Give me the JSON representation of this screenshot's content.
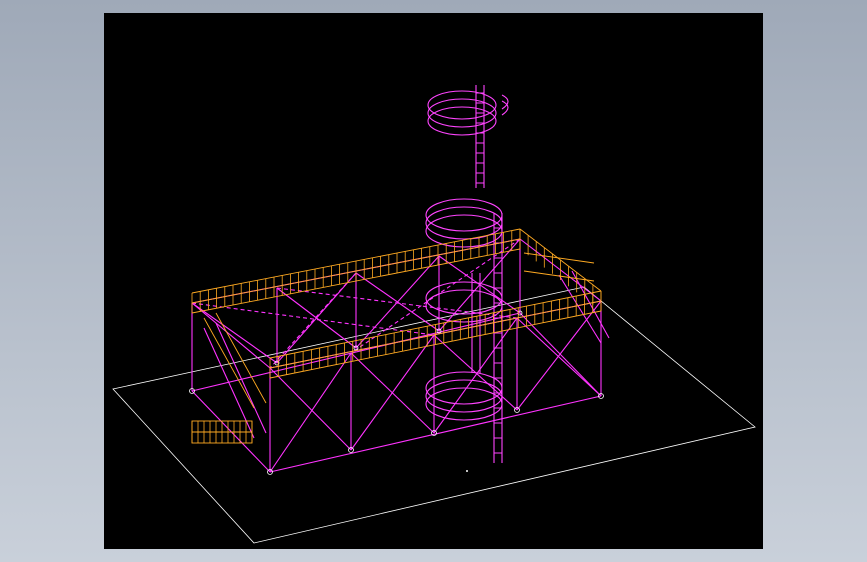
{
  "viewport": {
    "background": "#000000",
    "frame_background": "#b3bcc8"
  },
  "colors": {
    "structure": "#ff33ff",
    "railing": "#ffaa22",
    "ground": "#ffffff",
    "ladder": "#ff44ff"
  },
  "model": {
    "description_icon": "steel-platform-3d-wireframe",
    "parts": [
      "ground-plane",
      "truss-frame",
      "railing",
      "stair",
      "ladder-cage",
      "tank-rings"
    ]
  }
}
